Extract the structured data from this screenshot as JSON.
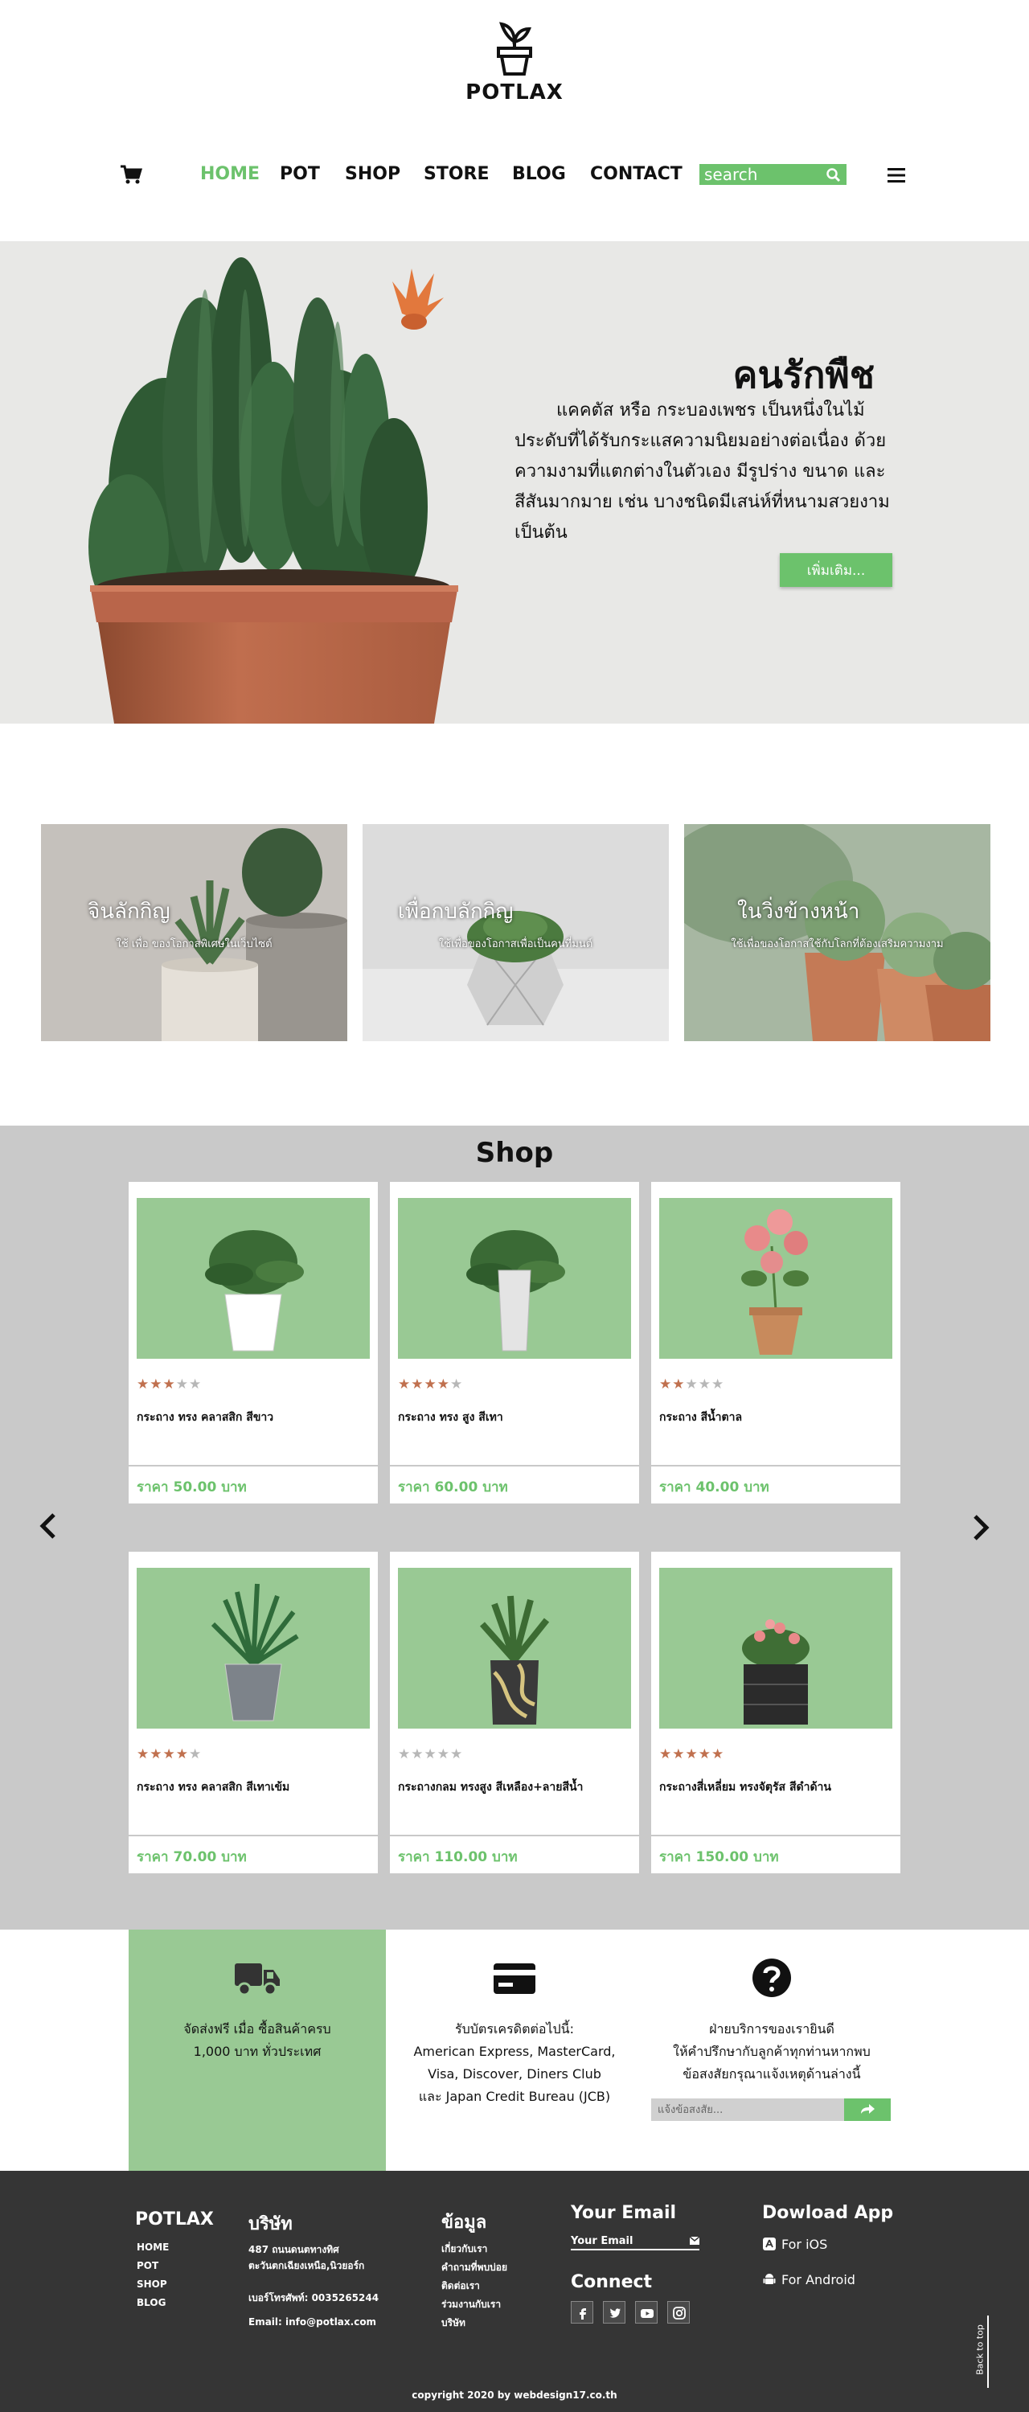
{
  "brand": {
    "name": "POTLAX"
  },
  "nav": {
    "items": [
      {
        "label": "HOME",
        "active": true
      },
      {
        "label": "POT",
        "active": false
      },
      {
        "label": "SHOP",
        "active": false
      },
      {
        "label": "STORE",
        "active": false
      },
      {
        "label": "BLOG",
        "active": false
      },
      {
        "label": "CONTACT",
        "active": false
      }
    ],
    "search_placeholder": "search",
    "icons": {
      "cart": "cart-icon",
      "search": "search-icon",
      "menu": "hamburger-icon"
    }
  },
  "hero": {
    "title": "คนรักพืช",
    "text": "แคคตัส หรือ กระบองเพชร เป็นหนึ่งในไม้ประดับที่ได้รับกระแสความนิยมอย่างต่อเนื่อง ด้วยความงามที่แตกต่างในตัวเอง มีรูปร่าง ขนาด และสีสันมากมาย เช่น บางชนิดมีเสน่ห์ที่หนามสวยงาม เป็นต้น",
    "button": "เพิ่มเติม..."
  },
  "features": [
    {
      "title": "จินลักกิญ",
      "subtitle": "ใช้ เพื่อ ของโอกาสพิเศษในเว็บไซต์"
    },
    {
      "title": "เพื่อกบลักกิญ",
      "subtitle": "ใช้เพื่อของโอกาสเพื่อเป็นคนที่มนต์"
    },
    {
      "title": "ในวิ่งข้างหน้า",
      "subtitle": "ใช้เพื่อของโอกาสใช้กับโลกที่ต้องเสริมความงาม"
    }
  ],
  "shop": {
    "title": "Shop",
    "products": [
      {
        "name": "กระถาง ทรง คลาสสิก สีขาว",
        "rating": 3,
        "price": "ราคา 50.00 บาท",
        "pot_color": "#ffffff",
        "pot_type": "round"
      },
      {
        "name": "กระถาง ทรง สูง สีเทา",
        "rating": 4,
        "price": "ราคา 60.00 บาท",
        "pot_color": "#e4e4e4",
        "pot_type": "tall"
      },
      {
        "name": "กระถาง สีน้ำตาล",
        "rating": 2,
        "price": "ราคา 40.00 บาท",
        "pot_color": "#c88a5c",
        "pot_type": "terracotta"
      },
      {
        "name": "กระถาง ทรง คลาสสิก สีเทาเข้ม",
        "rating": 4,
        "price": "ราคา 70.00 บาท",
        "pot_color": "#7d838a",
        "pot_type": "round"
      },
      {
        "name": "กระถางกลม ทรงสูง สีเหลือง+ลายสีน้ำ",
        "rating": 0,
        "price": "ราคา 110.00 บาท",
        "pot_color": "#3a3a3a",
        "pot_type": "marble"
      },
      {
        "name": "กระถางสี่เหลี่ยม ทรงจัตุรัส สีดำด้าน",
        "rating": 5,
        "price": "ราคา 150.00 บาท",
        "pot_color": "#2b2b2b",
        "pot_type": "square"
      }
    ],
    "colors": {
      "panel": "#99c994",
      "star_on": "#c0704e",
      "star_off": "#b7b7b7",
      "price": "#6cc26c"
    }
  },
  "services": {
    "shipping": {
      "icon": "truck-icon",
      "text": "จัดส่งฟรี เมื่อ ซื้อสินค้าครบ\n1,000 บาท ทั่วประเทศ"
    },
    "payment": {
      "icon": "credit-card-icon",
      "text": "รับบัตรเครดิตต่อไปนี้:\nAmerican Express, MasterCard,\nVisa, Discover, Diners Club\nและ Japan Credit Bureau (JCB)"
    },
    "support": {
      "icon": "question-icon",
      "text": "ฝ่ายบริการของเรายินดี\nให้คำปรึกษากับลูกค้าทุกท่านหากพบ\nข้อสงสัยกรุณาแจ้งเหตุด้านล่างนี้",
      "placeholder": "แจ้งข้อสงสัย...",
      "send_icon": "share-arrow-icon"
    }
  },
  "footer": {
    "brand": "POTLAX",
    "brand_links": [
      "HOME",
      "POT",
      "SHOP",
      "BLOG"
    ],
    "company": {
      "title": "บริษัท",
      "address": "487 ถนนดนตทางทิศ\nตะวันตกเฉียงเหนือ,นิวยอร์ก",
      "phone": "เบอร์โทรศัพท์: 0035265244",
      "email": "Email: info@potlax.com"
    },
    "info": {
      "title": "ข้อมูล",
      "links": [
        "เกี่ยวกับเรา",
        "คำถามที่พบบ่อย",
        "ติดต่อเรา",
        "ร่วมงานกับเรา",
        "บริษัท"
      ]
    },
    "your_email": {
      "title": "Your Email",
      "label": "Your Email"
    },
    "connect": {
      "title": "Connect",
      "icons": [
        "facebook-icon",
        "twitter-icon",
        "youtube-icon",
        "instagram-icon"
      ]
    },
    "app": {
      "title": "Dowload App",
      "ios": "For iOS",
      "android": "For Android"
    },
    "back_to_top": "Back to top",
    "copyright": "copyright 2020 by webdesign17.co.th"
  }
}
